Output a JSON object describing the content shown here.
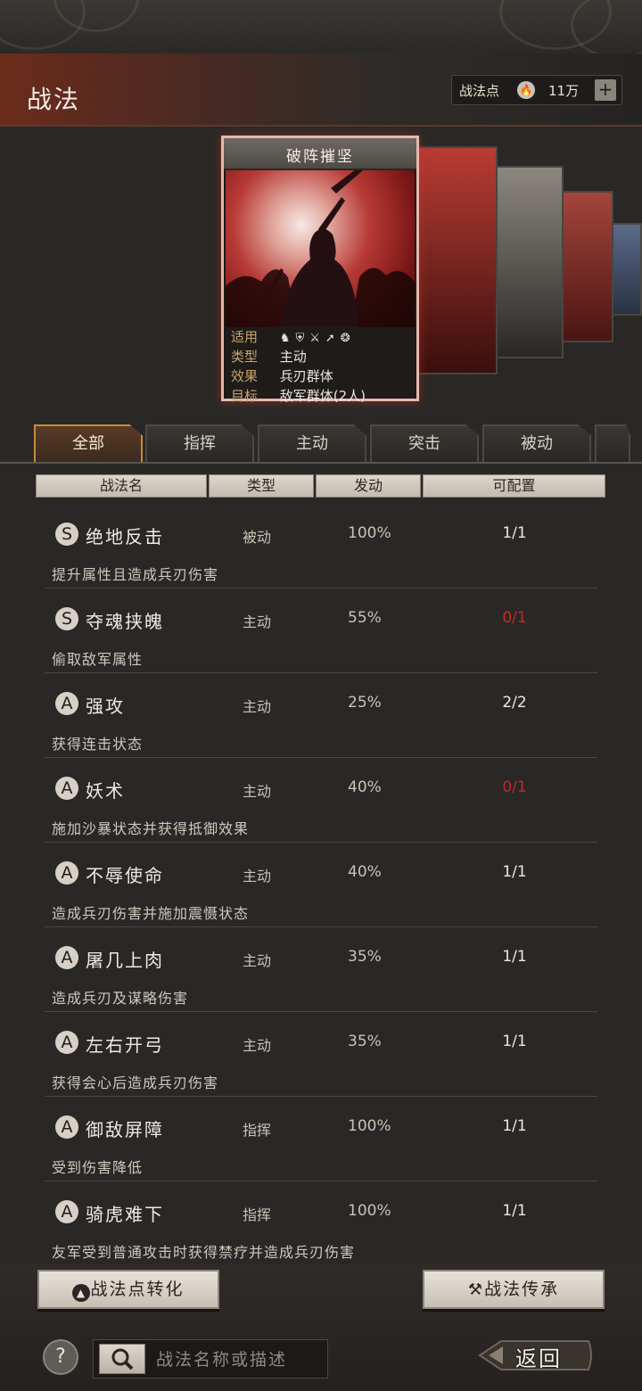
{
  "header": {
    "title": "战法",
    "points_label": "战法点",
    "points_value": "11万",
    "points_plus": "+"
  },
  "card": {
    "name": "破阵摧坚",
    "info": [
      {
        "key": "适用",
        "value": ""
      },
      {
        "key": "类型",
        "value": "主动"
      },
      {
        "key": "效果",
        "value": "兵刃群体"
      },
      {
        "key": "目标",
        "value": "敌军群体(2人)"
      }
    ],
    "applicable_icons": [
      "cavalry-icon",
      "shield-icon",
      "crossed-swords-icon",
      "spear-icon",
      "wheel-icon"
    ]
  },
  "tabs": [
    {
      "label": "全部",
      "active": true
    },
    {
      "label": "指挥",
      "active": false
    },
    {
      "label": "主动",
      "active": false
    },
    {
      "label": "突击",
      "active": false
    },
    {
      "label": "被动",
      "active": false
    }
  ],
  "columns": {
    "name": "战法名",
    "type": "类型",
    "trigger": "发动",
    "config": "可配置"
  },
  "skills": [
    {
      "grade": "S",
      "name": "绝地反击",
      "type": "被动",
      "rate": "100%",
      "config": "1/1",
      "desc": "提升属性且造成兵刃伤害"
    },
    {
      "grade": "S",
      "name": "夺魂挟魄",
      "type": "主动",
      "rate": "55%",
      "config": "0/1",
      "desc": "偷取敌军属性"
    },
    {
      "grade": "A",
      "name": "强攻",
      "type": "主动",
      "rate": "25%",
      "config": "2/2",
      "desc": "获得连击状态"
    },
    {
      "grade": "A",
      "name": "妖术",
      "type": "主动",
      "rate": "40%",
      "config": "0/1",
      "desc": "施加沙暴状态并获得抵御效果"
    },
    {
      "grade": "A",
      "name": "不辱使命",
      "type": "主动",
      "rate": "40%",
      "config": "1/1",
      "desc": "造成兵刃伤害并施加震慑状态"
    },
    {
      "grade": "A",
      "name": "屠几上肉",
      "type": "主动",
      "rate": "35%",
      "config": "1/1",
      "desc": "造成兵刃及谋略伤害"
    },
    {
      "grade": "A",
      "name": "左右开弓",
      "type": "主动",
      "rate": "35%",
      "config": "1/1",
      "desc": "获得会心后造成兵刃伤害"
    },
    {
      "grade": "A",
      "name": "御敌屏障",
      "type": "指挥",
      "rate": "100%",
      "config": "1/1",
      "desc": "受到伤害降低"
    },
    {
      "grade": "A",
      "name": "骑虎难下",
      "type": "指挥",
      "rate": "100%",
      "config": "1/1",
      "desc": "友军受到普通攻击时获得禁疗并造成兵刃伤害"
    }
  ],
  "bottom": {
    "convert_label": "战法点转化",
    "inherit_label": "战法传承",
    "help_label": "?",
    "search_placeholder": "战法名称或描述",
    "back_label": "返回"
  },
  "colors": {
    "config_unavailable": "#c22a22",
    "tab_active_border": "#c88a3a",
    "card_border": "#e8b7ae"
  }
}
